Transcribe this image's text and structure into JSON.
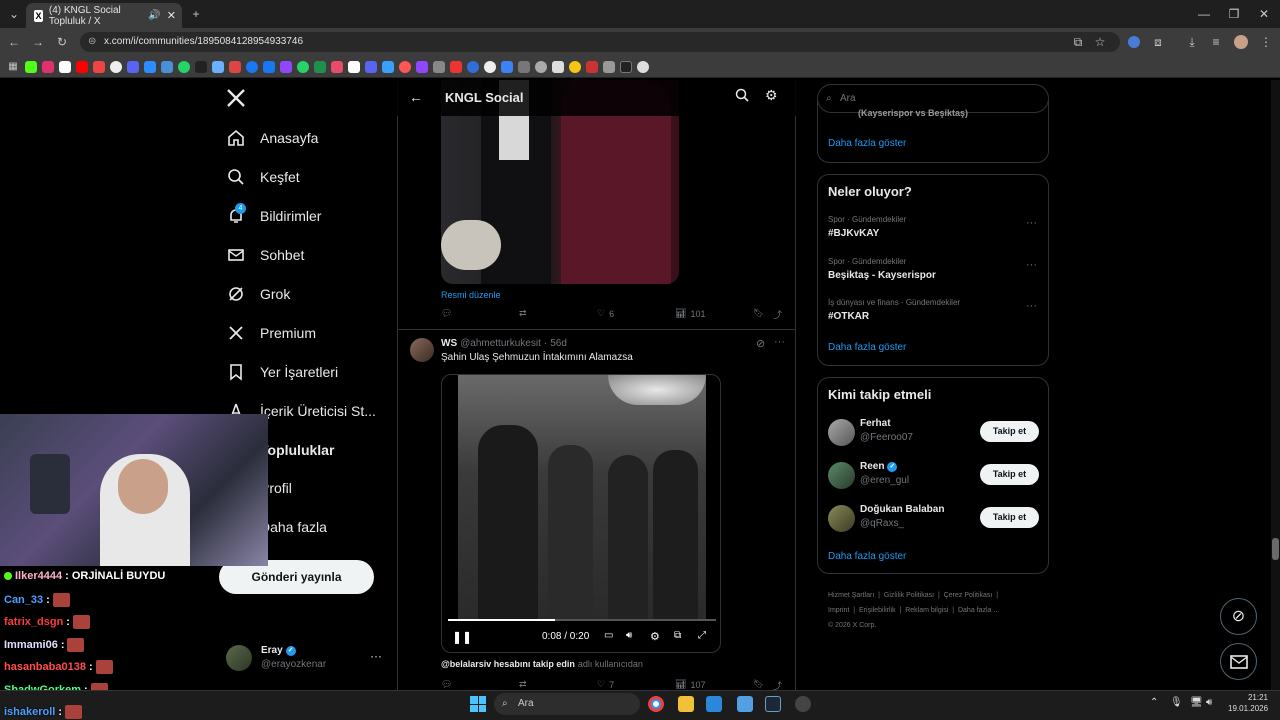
{
  "browser": {
    "tab_title": "(4) KNGL Social Topluluk / X",
    "url": "x.com/i/communities/1895084128954933746",
    "new_tab": "+",
    "accent": "#1d9bf0"
  },
  "nav": {
    "items": [
      {
        "label": "Anasayfa",
        "icon": "home-icon"
      },
      {
        "label": "Keşfet",
        "icon": "search-icon"
      },
      {
        "label": "Bildirimler",
        "icon": "bell-icon",
        "badge": "4"
      },
      {
        "label": "Sohbet",
        "icon": "mail-icon"
      },
      {
        "label": "Grok",
        "icon": "grok-icon"
      },
      {
        "label": "Premium",
        "icon": "x-logo-icon"
      },
      {
        "label": "Yer İşaretleri",
        "icon": "bookmark-icon"
      },
      {
        "label": "İçerik Üreticisi St...",
        "icon": "creator-icon"
      },
      {
        "label": "Topluluklar",
        "icon": "people-icon"
      },
      {
        "label": "Profil",
        "icon": "person-icon"
      },
      {
        "label": "Daha fazla",
        "icon": "more-icon"
      }
    ],
    "post_button": "Gönderi yayınla",
    "account_name": "Eray",
    "account_handle": "@erayozkenar"
  },
  "header": {
    "title": "KNGL Social"
  },
  "post1": {
    "edit_link": "Resmi düzenle",
    "likes": "6",
    "views": "101"
  },
  "post2": {
    "author": "WS",
    "handle": "@ahmetturkukesit",
    "time": "56d",
    "text": "Şahin Ulaş Şehmuzun İntakımını Alamazsa",
    "video_time": "0:08 / 0:20",
    "progress": 0.4,
    "caption_user": "@belalarsiv hesabını takip edin",
    "caption_rest": "adlı kullanıcıdan",
    "likes": "7",
    "views": "107"
  },
  "right": {
    "search_placeholder": "Ara",
    "truncated_trend": "(Kayserispor vs Beşiktaş)",
    "show_more": "Daha fazla göster",
    "trends_title": "Neler oluyor?",
    "trends": [
      {
        "category": "Spor · Gündemdekiler",
        "name": "#BJKvKAY"
      },
      {
        "category": "Spor · Gündemdekiler",
        "name": "Beşiktaş - Kayserispor"
      },
      {
        "category": "İş dünyası ve finans · Gündemdekiler",
        "name": "#OTKAR"
      }
    ],
    "follow_title": "Kimi takip etmeli",
    "follow": [
      {
        "name": "Ferhat",
        "handle": "@Feeroo07",
        "verified": false
      },
      {
        "name": "Reen",
        "handle": "@eren_gul",
        "verified": true
      },
      {
        "name": "Doğukan Balaban",
        "handle": "@qRaxs_",
        "verified": false
      }
    ],
    "follow_btn": "Takip et",
    "footer": [
      "Hizmet Şartları",
      "Gizlilik Politikası",
      "Çerez Politikası",
      "Imprint",
      "Erişilebilirlik",
      "Reklam bilgisi",
      "Daha fazla ...",
      "© 2026 X Corp."
    ]
  },
  "chat": [
    {
      "user": "Ilker4444",
      "msg": ": ORJİNALİ BUYDU",
      "color": "#ffb3c6"
    },
    {
      "user": "Can_33",
      "msg": ":",
      "color": "#4d9fff"
    },
    {
      "user": "fatrix_dsgn",
      "msg": ":",
      "color": "#ff3b3b"
    },
    {
      "user": "Immami06",
      "msg": ":",
      "color": "#e0e0ff"
    },
    {
      "user": "hasanbaba0138",
      "msg": ":",
      "color": "#ff4d4d"
    },
    {
      "user": "ShadwGorkem",
      "msg": ":",
      "color": "#4dff88"
    },
    {
      "user": "ishakeroll",
      "msg": ":",
      "color": "#4d9fff"
    }
  ],
  "taskbar": {
    "search": "Ara",
    "time": "21:21",
    "date": "19.01.2026"
  }
}
